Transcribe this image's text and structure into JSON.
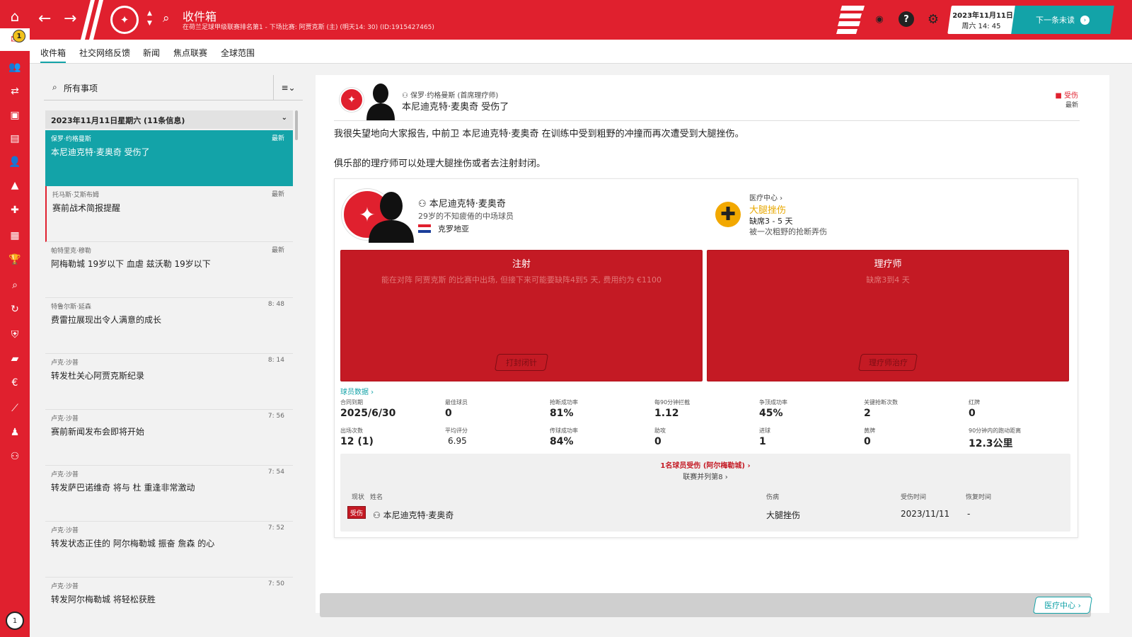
{
  "nav": {
    "inbox_badge": "1",
    "bottom_badge": "1",
    "items": [
      "home-icon",
      "inbox-icon",
      "squad-icon",
      "transfers-icon",
      "tactics-icon",
      "reports-icon",
      "staff-icon",
      "training-icon",
      "medical-icon",
      "schedule-icon",
      "competitions-icon",
      "scouting-icon",
      "development-icon",
      "club-info-icon",
      "finances-icon",
      "money-icon",
      "analytics-icon",
      "dev-centre-icon",
      "staff-search-icon"
    ]
  },
  "header": {
    "title": "收件箱",
    "subtitle": "在荷兰足球甲级联赛排名第1 - 下场比赛: 阿贾克斯 (主) (明天14: 30) (ID:1915427465)",
    "date_line1": "2023年11月11日",
    "date_line2": "周六 14: 45",
    "next_label": "下一条未读"
  },
  "tabs": [
    "收件箱",
    "社交网络反馈",
    "新闻",
    "焦点联赛",
    "全球范围"
  ],
  "inbox": {
    "filter_label": "所有事项",
    "group_label": "2023年11月11日星期六 (11条信息)",
    "messages": [
      {
        "from": "保罗·约格曼斯",
        "subject": "本尼迪克特·麦奥奇 受伤了",
        "time": "最新"
      },
      {
        "from": "托马斯·艾斯布姆",
        "subject": "赛前战术简报提醒",
        "time": "最新"
      },
      {
        "from": "帕特里克·穆勒",
        "subject": "阿梅勒城 19岁以下 血虐 兹沃勒 19岁以下",
        "time": "最新"
      },
      {
        "from": "特鲁尔斯·延森",
        "subject": "费雷拉展现出令人满意的成长",
        "time": "8: 48"
      },
      {
        "from": "卢克·沙普",
        "subject": "转发杜关心阿贾克斯纪录",
        "time": "8: 14"
      },
      {
        "from": "卢克·沙普",
        "subject": "赛前新闻发布会即将开始",
        "time": "7: 56"
      },
      {
        "from": "卢克·沙普",
        "subject": "转发萨巴诺维奇 将与 杜 重逢非常激动",
        "time": "7: 54"
      },
      {
        "from": "卢克·沙普",
        "subject": "转发状态正佳的 阿尔梅勒城 振奋 詹森 的心",
        "time": "7: 52"
      },
      {
        "from": "卢克·沙普",
        "subject": "转发阿尔梅勒城 将轻松获胜",
        "time": "7: 50"
      }
    ]
  },
  "message": {
    "from": "保罗·约格曼斯 (首席理疗师)",
    "subject": "本尼迪克特·麦奥奇 受伤了",
    "tag": "受伤",
    "tag_sub": "最新",
    "body1": "我很失望地向大家报告, 中前卫 本尼迪克特·麦奥奇 在训练中受到粗野的冲撞而再次遭受到大腿挫伤。",
    "body2": "俱乐部的理疗师可以处理大腿挫伤或者去注射封闭。"
  },
  "player": {
    "name": "本尼迪克特·麦奥奇",
    "description": "29岁的不知疲倦的中场球员",
    "nationality": "克罗地亚",
    "medical_link": "医疗中心",
    "injury": "大腿挫伤",
    "out_time": "缺席3 - 5 天",
    "cause": "被一次粗野的抢断弄伤"
  },
  "options": [
    {
      "title": "注射",
      "desc": "能在对阵 阿贾克斯 的比赛中出场, 但接下来可能要缺阵4到5 天, 费用约为 €1100",
      "button": "打封闭针"
    },
    {
      "title": "理疗师",
      "desc": "缺席3到4 天",
      "button": "理疗师治疗"
    }
  ],
  "stats_link": "球员数据",
  "stats": [
    {
      "label": "合同到期",
      "value": "2025/6/30"
    },
    {
      "label": "最佳球员",
      "value": "0"
    },
    {
      "label": "抢断成功率",
      "value": "81%"
    },
    {
      "label": "每90分钟拦截",
      "value": "1.12"
    },
    {
      "label": "争顶成功率",
      "value": "45%"
    },
    {
      "label": "关键抢断次数",
      "value": "2"
    },
    {
      "label": "红牌",
      "value": "0"
    },
    {
      "label": "出场次数",
      "value": "12 (1)"
    },
    {
      "label": "平均评分",
      "value": "6.95"
    },
    {
      "label": "传球成功率",
      "value": "84%"
    },
    {
      "label": "助攻",
      "value": "0"
    },
    {
      "label": "进球",
      "value": "1"
    },
    {
      "label": "黄牌",
      "value": "0"
    },
    {
      "label": "90分钟内的跑动距离",
      "value": "12.3公里"
    }
  ],
  "injuries": {
    "count_line": "1名球员受伤 (阿尔梅勒城)",
    "rank_line": "联赛并列第8",
    "headers": [
      "现状",
      "姓名",
      "伤病",
      "受伤时间",
      "恢复时间"
    ],
    "row": {
      "status": "受伤",
      "name": "本尼迪克特·麦奥奇",
      "injury": "大腿挫伤",
      "date": "2023/11/11",
      "return": "-"
    }
  },
  "footer": {
    "medical_button": "医疗中心"
  },
  "colors": {
    "brand": "#e0202e",
    "accent": "#13a3a8",
    "option": "#c41a24",
    "warning": "#f2a800"
  }
}
